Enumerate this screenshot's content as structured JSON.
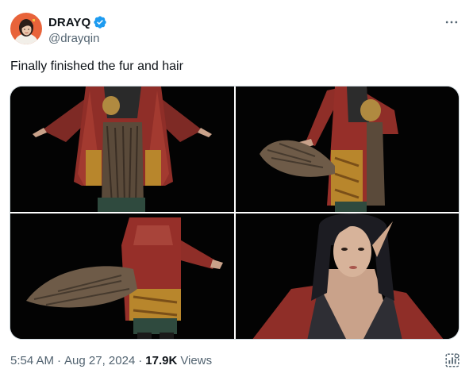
{
  "author": {
    "display_name": "DRAYQ",
    "handle": "@drayqin",
    "verified": true
  },
  "tweet": {
    "text": "Finally finished the fur and hair"
  },
  "media": [
    {
      "icon": "image",
      "subject": "character-front-t-pose"
    },
    {
      "icon": "image",
      "subject": "character-side-with-tail"
    },
    {
      "icon": "image",
      "subject": "character-back-with-tail"
    },
    {
      "icon": "image",
      "subject": "elf-woman-portrait"
    }
  ],
  "meta": {
    "time": "5:54 AM",
    "separator": "·",
    "date": "Aug 27, 2024",
    "views_count": "17.9K",
    "views_label": "Views"
  },
  "colors": {
    "text_primary": "#0f1419",
    "text_secondary": "#536471",
    "verified_blue": "#1d9bf0",
    "border": "#cfd9de"
  },
  "icons": {
    "more": "more-horizontal-icon",
    "verified": "verified-badge-icon",
    "analytics": "analytics-icon"
  }
}
